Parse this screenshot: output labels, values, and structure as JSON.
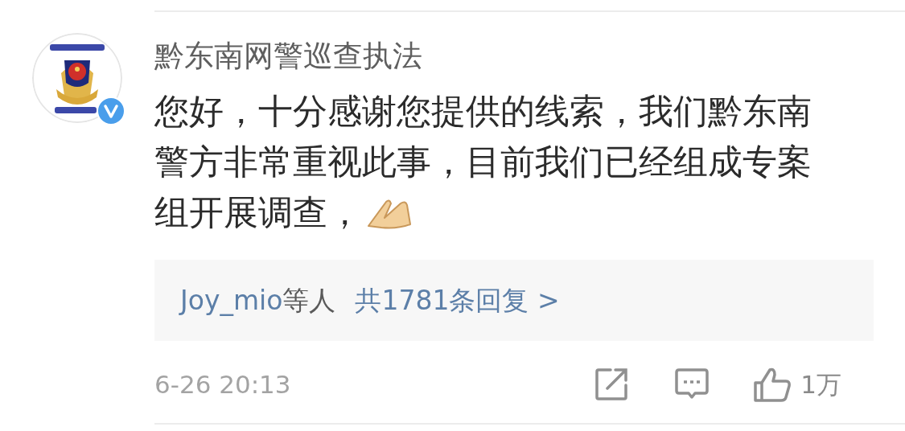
{
  "comment": {
    "author": "黔东南网警巡查执法",
    "verified": true,
    "text_lines": [
      "您好，十分感谢您提供的线索，我们黔东南",
      "警方非常重视此事，目前我们已经组成专案",
      "组开展调查，"
    ],
    "replies": {
      "users": "Joy_mio",
      "suffix": "等人",
      "total": "共1781条回复 >"
    },
    "time": "6-26 20:13",
    "like_count": "1万"
  }
}
